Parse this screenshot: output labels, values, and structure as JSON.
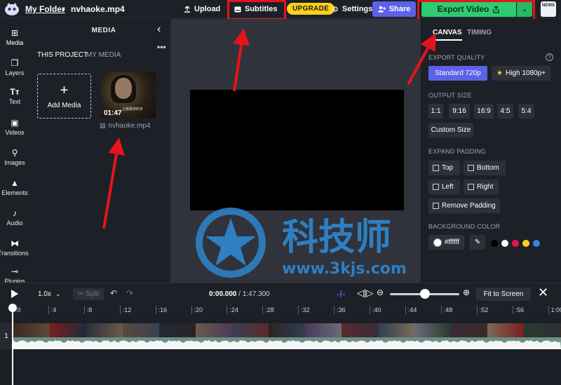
{
  "header": {
    "folder": "My Folder",
    "separator": "›",
    "file_name": "nvhaoke.mp4",
    "upload_label": "Upload",
    "subtitles_label": "Subtitles",
    "upgrade_label": "UPGRADE",
    "settings_label": "Settings",
    "share_label": "Share",
    "export_label": "Export Video",
    "news_label": "NEWS"
  },
  "rail": {
    "items": [
      {
        "label": "Media",
        "icon": "media-icon"
      },
      {
        "label": "Layers",
        "icon": "layers-icon"
      },
      {
        "label": "Text",
        "icon": "text-icon"
      },
      {
        "label": "Videos",
        "icon": "videos-icon"
      },
      {
        "label": "Images",
        "icon": "images-icon"
      },
      {
        "label": "Elements",
        "icon": "elements-icon"
      },
      {
        "label": "Audio",
        "icon": "audio-icon"
      },
      {
        "label": "Transitions",
        "icon": "transitions-icon"
      },
      {
        "label": "Plugins",
        "icon": "plugins-icon"
      }
    ]
  },
  "media": {
    "title": "MEDIA",
    "tab_project": "THIS PROJECT",
    "tab_my_media": "MY MEDIA",
    "add_label": "Add Media",
    "item": {
      "duration": "01:47",
      "name": "nvhaoke.mp4",
      "subtitle_text": "让我看你的手"
    }
  },
  "watermark": {
    "cn": "科技师",
    "url": "www.3kjs.com"
  },
  "right_panel": {
    "tab_canvas": "CANVAS",
    "tab_timing": "TIMING",
    "export_quality_label": "EXPORT QUALITY",
    "quality_standard": "Standard 720p",
    "quality_high": "High 1080p+",
    "output_size_label": "OUTPUT SIZE",
    "sizes": [
      "1:1",
      "9:16",
      "16:9",
      "4:5",
      "5:4"
    ],
    "custom_size": "Custom Size",
    "expand_padding_label": "EXPAND PADDING",
    "pad_top": "Top",
    "pad_bottom": "Bottom",
    "pad_left": "Left",
    "pad_right": "Right",
    "pad_remove": "Remove Padding",
    "background_color_label": "BACKGROUND COLOR",
    "background_value": "#ffffff",
    "swatches": [
      "#000000",
      "#ffffff",
      "#e8174a",
      "#f7d31a",
      "#2f86e6"
    ]
  },
  "timeline": {
    "speed": "1.0x",
    "split_label": "Split",
    "time_current": "0:00.000",
    "time_total": "/ 1:47.300",
    "zoom_level": 0.5,
    "fit_label": "Fit to Screen",
    "track_number": "1",
    "ticks": [
      ":0",
      ":4",
      ":8",
      ":12",
      ":16",
      ":20",
      ":24",
      ":28",
      ":32",
      ":36",
      ":40",
      ":44",
      ":48",
      ":52",
      ":56",
      "1:00"
    ]
  }
}
